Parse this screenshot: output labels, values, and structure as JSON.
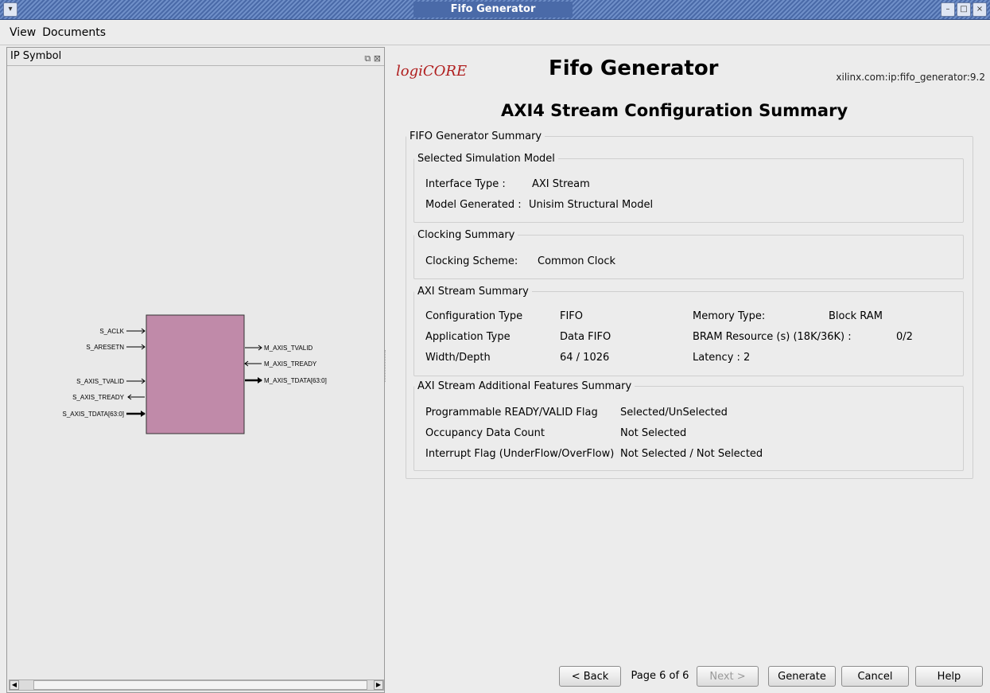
{
  "window": {
    "title": "Fifo Generator",
    "buttons": [
      "–",
      "□",
      "×"
    ]
  },
  "menu": {
    "items": [
      "View",
      "Documents"
    ]
  },
  "left_panel": {
    "title": "IP Symbol",
    "icons": [
      "restore-icon",
      "close-icon"
    ],
    "block_color": "#c08aa9",
    "inputs": [
      "S_ACLK",
      "S_ARESETN",
      "S_AXIS_TVALID",
      "S_AXIS_TREADY",
      "S_AXIS_TDATA[63:0]"
    ],
    "outputs": [
      "M_AXIS_TVALID",
      "M_AXIS_TREADY",
      "M_AXIS_TDATA[63:0]"
    ]
  },
  "header": {
    "logo_text": "logiCORE",
    "title": "Fifo Generator",
    "ip_id": "xilinx.com:ip:fifo_generator:9.2",
    "subtitle": "AXI4 Stream Configuration Summary"
  },
  "summary": {
    "legend": "FIFO Generator Summary",
    "sim_model": {
      "legend": "Selected Simulation Model",
      "interface_label": "Interface Type :",
      "interface_value": "AXI Stream",
      "model_label": "Model Generated :",
      "model_value": "Unisim Structural Model"
    },
    "clocking": {
      "legend": "Clocking Summary",
      "label": "Clocking Scheme:",
      "value": "Common Clock"
    },
    "axi_stream": {
      "legend": "AXI Stream Summary",
      "config_label": "Configuration Type",
      "config_value": "FIFO",
      "app_label": "Application  Type",
      "app_value": "Data FIFO",
      "width_label": "Width/Depth",
      "width_value": "64 / 1026",
      "mem_label": "Memory Type:",
      "mem_value": "Block RAM",
      "bram_label": "BRAM Resource (s) (18K/36K) :",
      "bram_value": "0/2",
      "latency_label": "Latency : 2"
    },
    "additional": {
      "legend": "AXI Stream Additional Features Summary",
      "prog_label": "Programmable READY/VALID Flag",
      "prog_value": "Selected/UnSelected",
      "occ_label": "Occupancy Data Count",
      "occ_value": "Not Selected",
      "int_label": "Interrupt Flag (UnderFlow/OverFlow)",
      "int_value": "Not Selected / Not Selected"
    }
  },
  "footer": {
    "back": "< Back",
    "page": "Page 6 of 6",
    "next": "Next >",
    "generate": "Generate",
    "cancel": "Cancel",
    "help": "Help"
  }
}
